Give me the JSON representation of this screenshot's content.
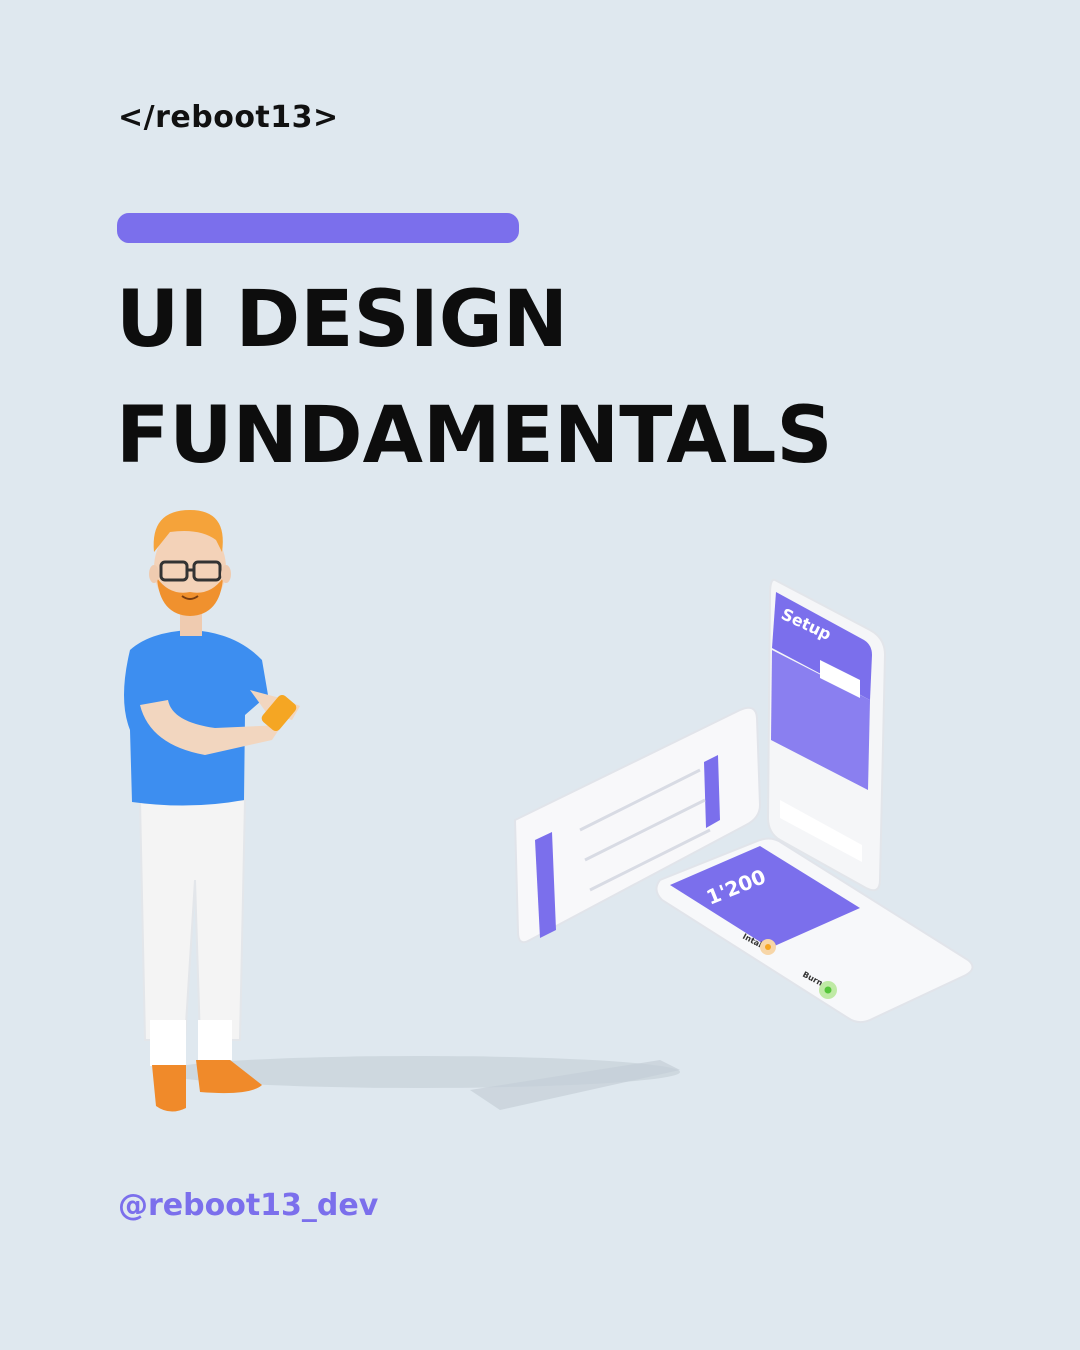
{
  "brand": {
    "logo_text": "</reboot13>"
  },
  "headline": {
    "line1": "UI DESIGN",
    "line2": "FUNDAMENTALS"
  },
  "phones": {
    "setup_title": "Setup",
    "calorie_value": "1'200",
    "intake_label": "Intake",
    "burned_label": "Burned"
  },
  "footer": {
    "handle": "@reboot13_dev"
  },
  "colors": {
    "background": "#dfe8ef",
    "accent": "#7b6fec",
    "text": "#0d0d0d",
    "shirt": "#3d8ef0",
    "hair": "#f5a33a"
  },
  "icons": [
    "person-illustration",
    "phone-mockup-illustration"
  ]
}
